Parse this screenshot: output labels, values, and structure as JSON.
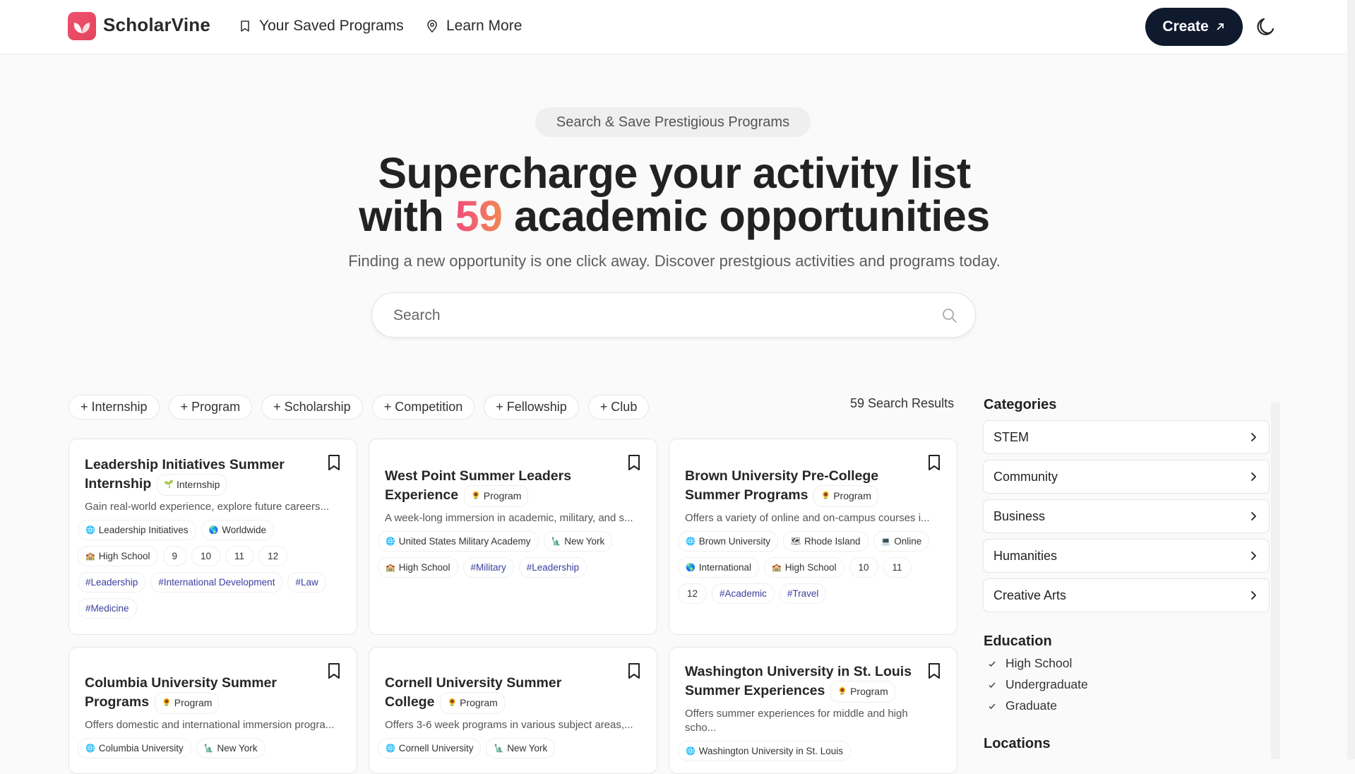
{
  "header": {
    "brand": "ScholarVine",
    "nav": [
      {
        "label": "Your Saved Programs",
        "icon": "bookmark-icon"
      },
      {
        "label": "Learn More",
        "icon": "map-pin-icon"
      }
    ],
    "create_label": "Create",
    "create_icon": "arrow-up-right-icon",
    "theme_icon": "moon-icon"
  },
  "hero": {
    "badge": "Search & Save Prestigious Programs",
    "title_line1": "Supercharge your activity list",
    "title_pre": "with ",
    "title_count": "59",
    "title_post": " academic opportunities",
    "subtitle": "Finding a new opportunity is one click away. Discover prestgious activities and programs today.",
    "search_placeholder": "Search"
  },
  "filters": [
    "+ Internship",
    "+ Program",
    "+ Scholarship",
    "+ Competition",
    "+ Fellowship",
    "+ Club"
  ],
  "results_count": "59 Search Results",
  "cards": [
    {
      "title": "Leadership Initiatives Summer Internship",
      "type": "Internship",
      "type_icon": "🌱",
      "desc": "Gain real-world experience, explore future careers...",
      "tags": [
        {
          "icon": "🌐",
          "text": "Leadership Initiatives"
        },
        {
          "icon": "🌎",
          "text": "Worldwide"
        },
        {
          "icon": "🏫",
          "text": "High School"
        },
        {
          "text": "9"
        },
        {
          "text": "10"
        },
        {
          "text": "11"
        },
        {
          "text": "12"
        },
        {
          "hash": "#",
          "text": "Leadership"
        },
        {
          "hash": "#",
          "text": "International Development"
        },
        {
          "hash": "#",
          "text": "Law"
        },
        {
          "hash": "#",
          "text": "Medicine"
        }
      ]
    },
    {
      "title": "West Point Summer Leaders Experience",
      "type": "Program",
      "type_icon": "🌻",
      "desc": "A week-long immersion in academic, military, and s...",
      "tags": [
        {
          "icon": "🌐",
          "text": "United States Military Academy"
        },
        {
          "icon": "🗽",
          "text": "New York"
        },
        {
          "icon": "🏫",
          "text": "High School"
        },
        {
          "hash": "#",
          "text": "Military"
        },
        {
          "hash": "#",
          "text": "Leadership"
        }
      ]
    },
    {
      "title": "Brown University Pre-College Summer Programs",
      "type": "Program",
      "type_icon": "🌻",
      "desc": "Offers a variety of online and on-campus courses i...",
      "tags": [
        {
          "icon": "🌐",
          "text": "Brown University"
        },
        {
          "icon": "🗺",
          "text": "Rhode Island"
        },
        {
          "icon": "💻",
          "text": "Online"
        },
        {
          "icon": "🌎",
          "text": "International"
        },
        {
          "icon": "🏫",
          "text": "High School"
        },
        {
          "text": "10"
        },
        {
          "text": "11"
        },
        {
          "text": "12"
        },
        {
          "hash": "#",
          "text": "Academic"
        },
        {
          "hash": "#",
          "text": "Travel"
        }
      ]
    },
    {
      "title": "Columbia University Summer Programs",
      "type": "Program",
      "type_icon": "🌻",
      "desc": "Offers domestic and international immersion progra...",
      "tags": [
        {
          "icon": "🌐",
          "text": "Columbia University"
        },
        {
          "icon": "🗽",
          "text": "New York"
        }
      ]
    },
    {
      "title": "Cornell University Summer College",
      "type": "Program",
      "type_icon": "🌻",
      "desc": "Offers 3-6 week programs in various subject areas,...",
      "tags": [
        {
          "icon": "🌐",
          "text": "Cornell University"
        },
        {
          "icon": "🗽",
          "text": "New York"
        }
      ]
    },
    {
      "title": "Washington University in St. Louis Summer Experiences",
      "type": "Program",
      "type_icon": "🌻",
      "desc": "Offers summer experiences for middle and high scho...",
      "tags": [
        {
          "icon": "🌐",
          "text": "Washington University in St. Louis"
        }
      ]
    }
  ],
  "sidebar": {
    "categories_heading": "Categories",
    "categories": [
      "STEM",
      "Community",
      "Business",
      "Humanities",
      "Creative Arts"
    ],
    "education_heading": "Education",
    "education": [
      "High School",
      "Undergraduate",
      "Graduate"
    ],
    "locations_heading": "Locations"
  },
  "colors": {
    "brand": "#e9485f",
    "create_bg": "#0f1a2e",
    "hashtag": "#3b3f9e",
    "accent_gradient": [
      "#f04d7a",
      "#f08a55"
    ]
  }
}
